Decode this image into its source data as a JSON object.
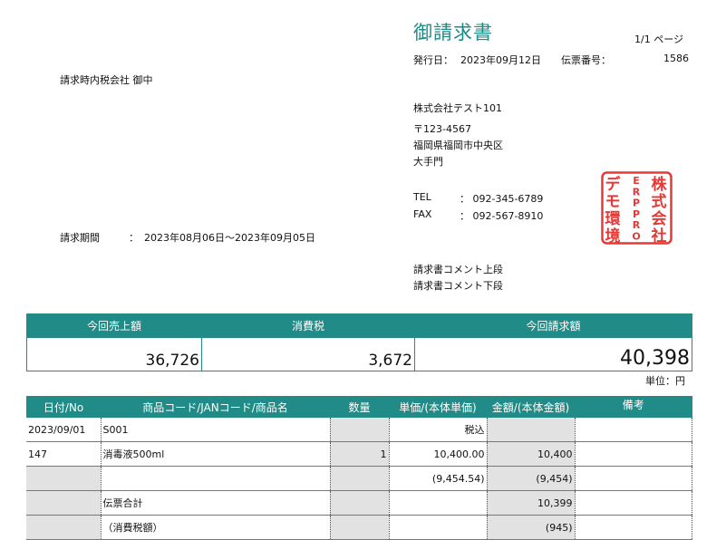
{
  "doc": {
    "title": "御請求書",
    "page": "1/1 ページ",
    "issue_label": "発行日：",
    "issue_date": "2023年09月12日",
    "slip_label": "伝票番号：",
    "slip_no": "1586"
  },
  "customer": {
    "name": "請求時内税会社 御中"
  },
  "period": {
    "label": "請求期間",
    "sep": "：",
    "value": "2023年08月06日～2023年09月05日"
  },
  "issuer": {
    "company": "株式会社テスト101",
    "postal": "〒123-4567",
    "address1": "福岡県福岡市中央区",
    "address2": "大手門",
    "tel_label": "TEL",
    "tel": "：  092-345-6789",
    "fax_label": "FAX",
    "fax": "：  092-567-8910",
    "comment_upper": "請求書コメント上段",
    "comment_lower": "請求書コメント下段"
  },
  "stamp": {
    "chars": [
      "デ",
      "モ",
      "環",
      "境",
      "E",
      "R",
      "P",
      "P",
      "R",
      "O",
      "株",
      "式",
      "会",
      "社"
    ],
    "color": "#e53935"
  },
  "summary": {
    "headers": [
      "今回売上額",
      "消費税",
      "今回請求額"
    ],
    "sales": "36,726",
    "tax": "3,672",
    "total": "40,398",
    "unit": "単位：円"
  },
  "table": {
    "headers": [
      "日付/No",
      "商品コード/JANコード/商品名",
      "数量",
      "単価/(本体単価)",
      "金額/(本体金額)",
      "備考"
    ],
    "rows": [
      [
        "2023/09/01",
        "S001",
        "",
        "税込",
        "",
        ""
      ],
      [
        "147",
        "消毒液500ml",
        "1",
        "10,400.00",
        "10,400",
        ""
      ],
      [
        "",
        "",
        "",
        "(9,454.54)",
        "(9,454)",
        ""
      ],
      [
        "",
        "伝票合計",
        "",
        "",
        "10,399",
        ""
      ],
      [
        "",
        "（消費税額）",
        "",
        "",
        "(945)",
        ""
      ]
    ]
  },
  "colors": {
    "accent": "#218b87",
    "stamp": "#e53935"
  }
}
